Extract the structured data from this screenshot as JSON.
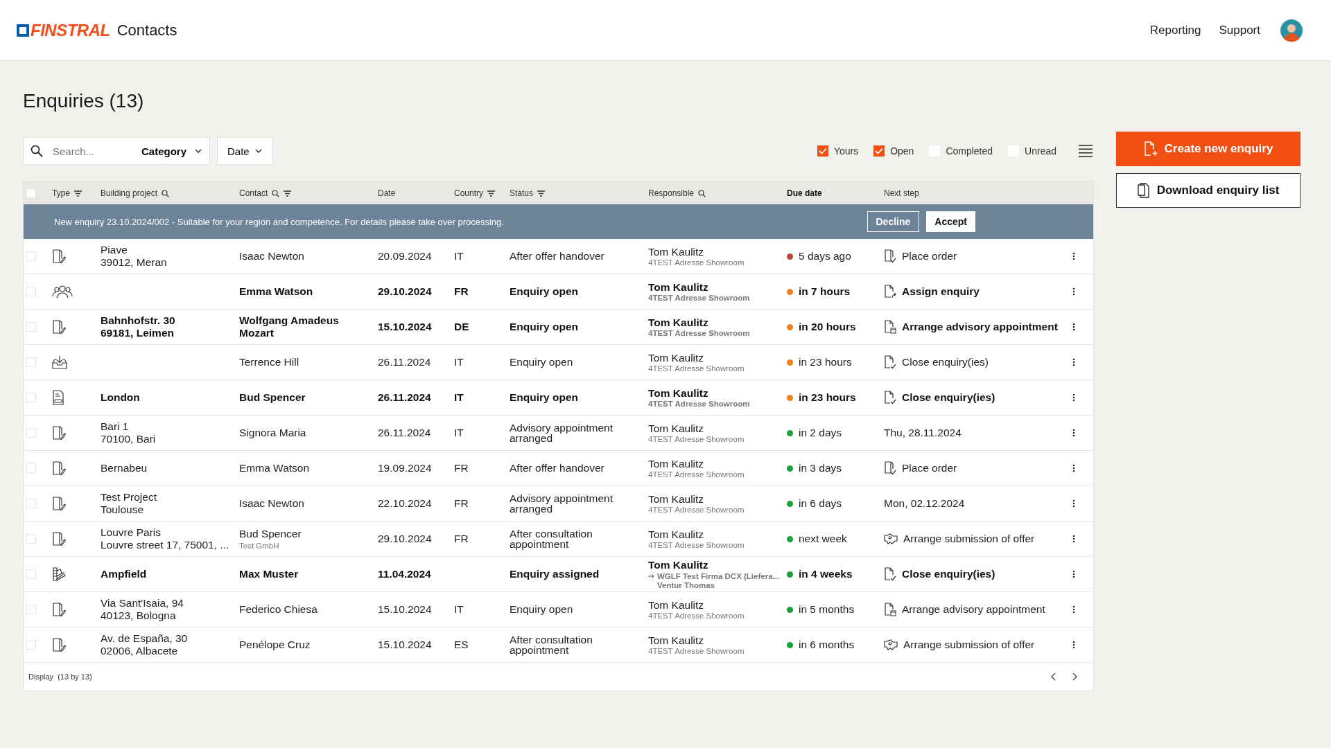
{
  "header": {
    "brand": "FINSTRAL",
    "app_name": "Contacts",
    "nav": [
      "Reporting",
      "Support"
    ]
  },
  "page_title": "Enquiries (13)",
  "search": {
    "placeholder": "Search..."
  },
  "category_dropdown": "Category",
  "date_dropdown": "Date",
  "filters": [
    {
      "label": "Yours",
      "checked": true
    },
    {
      "label": "Open",
      "checked": true
    },
    {
      "label": "Completed",
      "checked": false
    },
    {
      "label": "Unread",
      "checked": false
    }
  ],
  "actions": [
    {
      "label": "Create new enquiry",
      "kind": "primary"
    },
    {
      "label": "Download enquiry list",
      "kind": "secondary"
    }
  ],
  "table": {
    "select_all": {
      "checked": false
    },
    "columns": [
      {
        "label": "Type",
        "filter": true,
        "search": false,
        "bold": false
      },
      {
        "label": "Building project",
        "filter": false,
        "search": true,
        "bold": false
      },
      {
        "label": "Contact",
        "filter": true,
        "search": true,
        "bold": false
      },
      {
        "label": "Date",
        "filter": false,
        "search": false,
        "bold": false
      },
      {
        "label": "Country",
        "filter": true,
        "search": false,
        "bold": false
      },
      {
        "label": "Status",
        "filter": true,
        "search": false,
        "bold": false
      },
      {
        "label": "Responsible",
        "filter": false,
        "search": true,
        "bold": false
      },
      {
        "label": "Due date",
        "filter": false,
        "search": false,
        "bold": true
      },
      {
        "label": "Next step",
        "filter": false,
        "search": false,
        "bold": false
      }
    ],
    "banner": {
      "message": "New enquiry 23.10.2024/002 - Suitable for your region and competence. For details please take over processing.",
      "buttons": [
        "Decline",
        "Accept"
      ]
    },
    "rows": [
      {
        "selected": false,
        "unread": false,
        "kind": "door",
        "project": [
          "Piave",
          "39012, Meran"
        ],
        "contact": "Isaac Newton",
        "date": "20.09.2024",
        "country": "IT",
        "status": "After offer handover",
        "responsible": "Tom Kaulitz",
        "responsible_note": [
          "4TEST Adresse Showroom"
        ],
        "forwarded": false,
        "due": "5 days ago",
        "color": "#c0463f",
        "next_step": {
          "label": "Place order",
          "kind": "order"
        }
      },
      {
        "selected": false,
        "unread": true,
        "kind": "people",
        "project": [],
        "contact": "Emma Watson",
        "date": "29.10.2024",
        "country": "FR",
        "status": "Enquiry open",
        "responsible": "Tom Kaulitz",
        "responsible_note": [
          "4TEST Adresse Showroom"
        ],
        "forwarded": false,
        "due": "in 7 hours",
        "color": "#f0811f",
        "next_step": {
          "label": "Assign enquiry",
          "kind": "assign"
        }
      },
      {
        "selected": false,
        "unread": true,
        "kind": "door",
        "project": [
          "Bahnhofstr. 30",
          "69181, Leimen"
        ],
        "contact": "Wolfgang Amadeus Mozart",
        "date": "15.10.2024",
        "country": "DE",
        "status": "Enquiry open",
        "responsible": "Tom Kaulitz",
        "responsible_note": [
          "4TEST Adresse Showroom"
        ],
        "forwarded": false,
        "due": "in 20 hours",
        "color": "#f0811f",
        "next_step": {
          "label": "Arrange advisory appointment",
          "kind": "appointment"
        }
      },
      {
        "selected": false,
        "unread": false,
        "kind": "inbox",
        "project": [],
        "contact": "Terrence Hill",
        "date": "26.11.2024",
        "country": "IT",
        "status": "Enquiry open",
        "responsible": "Tom Kaulitz",
        "responsible_note": [
          "4TEST Adresse Showroom"
        ],
        "forwarded": false,
        "due": "in 23 hours",
        "color": "#f0811f",
        "next_step": {
          "label": "Close enquiry(ies)",
          "kind": "close"
        }
      },
      {
        "selected": false,
        "unread": true,
        "kind": "drawing",
        "project": [
          "London"
        ],
        "contact": "Bud Spencer",
        "date": "26.11.2024",
        "country": "IT",
        "status": "Enquiry open",
        "responsible": "Tom Kaulitz",
        "responsible_note": [
          "4TEST Adresse Showroom"
        ],
        "forwarded": false,
        "due": "in 23 hours",
        "color": "#f0811f",
        "next_step": {
          "label": "Close enquiry(ies)",
          "kind": "close"
        }
      },
      {
        "selected": false,
        "unread": false,
        "kind": "door",
        "project": [
          "Bari 1",
          "70100, Bari"
        ],
        "contact": "Signora Maria",
        "date": "26.11.2024",
        "country": "IT",
        "status": "Advisory appointment arranged",
        "responsible": "Tom Kaulitz",
        "responsible_note": [
          "4TEST Adresse Showroom"
        ],
        "forwarded": false,
        "due": "in 2 days",
        "color": "#1aa33a",
        "next_step": {
          "label": "Thu, 28.11.2024",
          "kind": "date"
        }
      },
      {
        "selected": false,
        "unread": false,
        "kind": "door",
        "project": [
          "Bernabeu"
        ],
        "contact": "Emma Watson",
        "date": "19.09.2024",
        "country": "FR",
        "status": "After offer handover",
        "responsible": "Tom Kaulitz",
        "responsible_note": [
          "4TEST Adresse Showroom"
        ],
        "forwarded": false,
        "due": "in 3 days",
        "color": "#1aa33a",
        "next_step": {
          "label": "Place order",
          "kind": "order"
        }
      },
      {
        "selected": false,
        "unread": false,
        "kind": "door",
        "project": [
          "Test Project",
          "Toulouse"
        ],
        "contact": "Isaac Newton",
        "date": "22.10.2024",
        "country": "FR",
        "status": "Advisory appointment arranged",
        "responsible": "Tom Kaulitz",
        "responsible_note": [
          "4TEST Adresse Showroom"
        ],
        "forwarded": false,
        "due": "in 6 days",
        "color": "#1aa33a",
        "next_step": {
          "label": "Mon, 02.12.2024",
          "kind": "date"
        }
      },
      {
        "selected": false,
        "unread": false,
        "kind": "door",
        "project": [
          "Louvre Paris",
          "Louvre street 17, 75001, ..."
        ],
        "contact": "Bud Spencer",
        "contact_note": "Test GmbH",
        "date": "29.10.2024",
        "country": "FR",
        "status": "After consultation appointment",
        "responsible": "Tom Kaulitz",
        "responsible_note": [
          "4TEST Adresse Showroom"
        ],
        "forwarded": false,
        "due": "next week",
        "color": "#1aa33a",
        "next_step": {
          "label": "Arrange submission of offer",
          "kind": "submission"
        }
      },
      {
        "selected": false,
        "unread": true,
        "kind": "swatch",
        "project": [
          "Ampfield"
        ],
        "contact": "Max Muster",
        "date": "11.04.2024",
        "status": "Enquiry assigned",
        "responsible": "Tom Kaulitz",
        "responsible_note": [
          "WGLF Test Firma DCX (Liefera...",
          "Ventur Thomas"
        ],
        "forwarded": true,
        "due": "in 4 weeks",
        "color": "#1aa33a",
        "next_step": {
          "label": "Close enquiry(ies)",
          "kind": "close"
        }
      },
      {
        "selected": false,
        "unread": false,
        "kind": "door",
        "project": [
          "Via Sant'Isaia, 94",
          "40123, Bologna"
        ],
        "contact": "Federico Chiesa",
        "date": "15.10.2024",
        "country": "IT",
        "status": "Enquiry open",
        "responsible": "Tom Kaulitz",
        "responsible_note": [
          "4TEST Adresse Showroom"
        ],
        "forwarded": false,
        "due": "in 5 months",
        "color": "#1aa33a",
        "next_step": {
          "label": "Arrange advisory appointment",
          "kind": "appointment"
        }
      },
      {
        "selected": false,
        "unread": false,
        "kind": "door",
        "project": [
          "Av. de España, 30",
          "02006, Albacete"
        ],
        "contact": "Penélope Cruz",
        "date": "15.10.2024",
        "country": "ES",
        "status": "After consultation appointment",
        "responsible": "Tom Kaulitz",
        "responsible_note": [
          "4TEST Adresse Showroom"
        ],
        "forwarded": false,
        "due": "in 6 months",
        "color": "#1aa33a",
        "next_step": {
          "label": "Arrange submission of offer",
          "kind": "submission"
        }
      }
    ]
  },
  "footer": {
    "display_label": "Display",
    "count": "(13 by 13)"
  }
}
